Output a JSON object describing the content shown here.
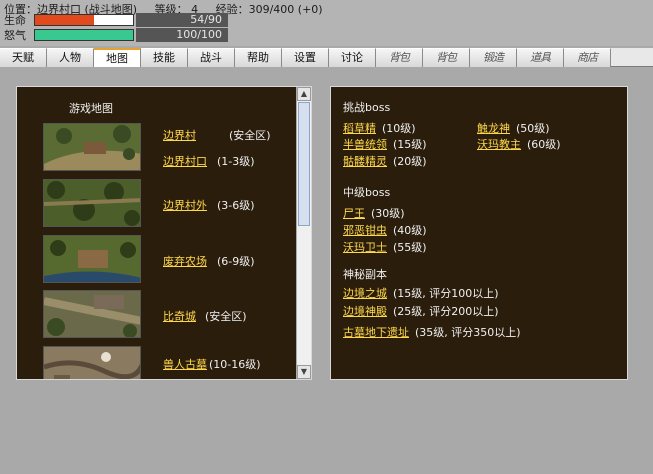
{
  "status": {
    "location": "位置：边界村口 (战斗地图)",
    "level": "等级： 4",
    "exp": "经验：309/400 (+0)",
    "hp": {
      "label": "生命",
      "value": "54/90",
      "fraction": 0.6,
      "color": "#e04a1c"
    },
    "rage": {
      "label": "怒气",
      "value": "100/100",
      "fraction": 1.0,
      "color": "#38c890"
    }
  },
  "tabs": [
    {
      "label": "天赋",
      "id": "talent"
    },
    {
      "label": "人物",
      "id": "character"
    },
    {
      "label": "地图",
      "id": "map",
      "active": true
    },
    {
      "label": "技能",
      "id": "skills"
    },
    {
      "label": "战斗",
      "id": "battle"
    },
    {
      "label": "帮助",
      "id": "help"
    },
    {
      "label": "设置",
      "id": "settings"
    },
    {
      "label": "讨论",
      "id": "discuss"
    },
    {
      "label": "背包",
      "id": "bag",
      "faded": true
    },
    {
      "label": "背包",
      "id": "bag2",
      "faded": true
    },
    {
      "label": "锻造",
      "id": "forge",
      "faded": true
    },
    {
      "label": "道具",
      "id": "items",
      "faded": true
    },
    {
      "label": "商店",
      "id": "shop",
      "faded": true
    }
  ],
  "maps_panel": {
    "title": "游戏地图",
    "maps": [
      {
        "name": "边界村",
        "level": "(安全区)"
      },
      {
        "name": "边界村口",
        "level": "(1-3级)"
      },
      {
        "name": "边界村外",
        "level": "(3-6级)"
      },
      {
        "name": "废弃农场",
        "level": "(6-9级)"
      },
      {
        "name": "比奇城",
        "level": "(安全区)"
      },
      {
        "name": "兽人古墓",
        "level": "(10-16级)"
      }
    ]
  },
  "challenge_panel": {
    "challenge_title": "挑战boss",
    "challenge_left": [
      {
        "name": "稻草精",
        "level": "(10级)"
      },
      {
        "name": "半兽统领",
        "level": "(15级)"
      },
      {
        "name": "骷髅精灵",
        "level": "(20级)"
      }
    ],
    "challenge_right": [
      {
        "name": "触龙神",
        "level": "(50级)"
      },
      {
        "name": "沃玛教主",
        "level": "(60级)"
      }
    ],
    "mid_title": "中级boss",
    "mid": [
      {
        "name": "尸王",
        "level": "(30级)"
      },
      {
        "name": "邪恶钳虫",
        "level": "(40级)"
      },
      {
        "name": "沃玛卫士",
        "level": "(55级)"
      }
    ],
    "secret_title": "神秘副本",
    "secret": [
      {
        "name": "边境之城",
        "level": "(15级, 评分100以上)"
      },
      {
        "name": "边境神殿",
        "level": "(25级, 评分200以上)"
      },
      {
        "name": "古墓地下遗址",
        "level": "(35级, 评分350以上)"
      }
    ]
  }
}
